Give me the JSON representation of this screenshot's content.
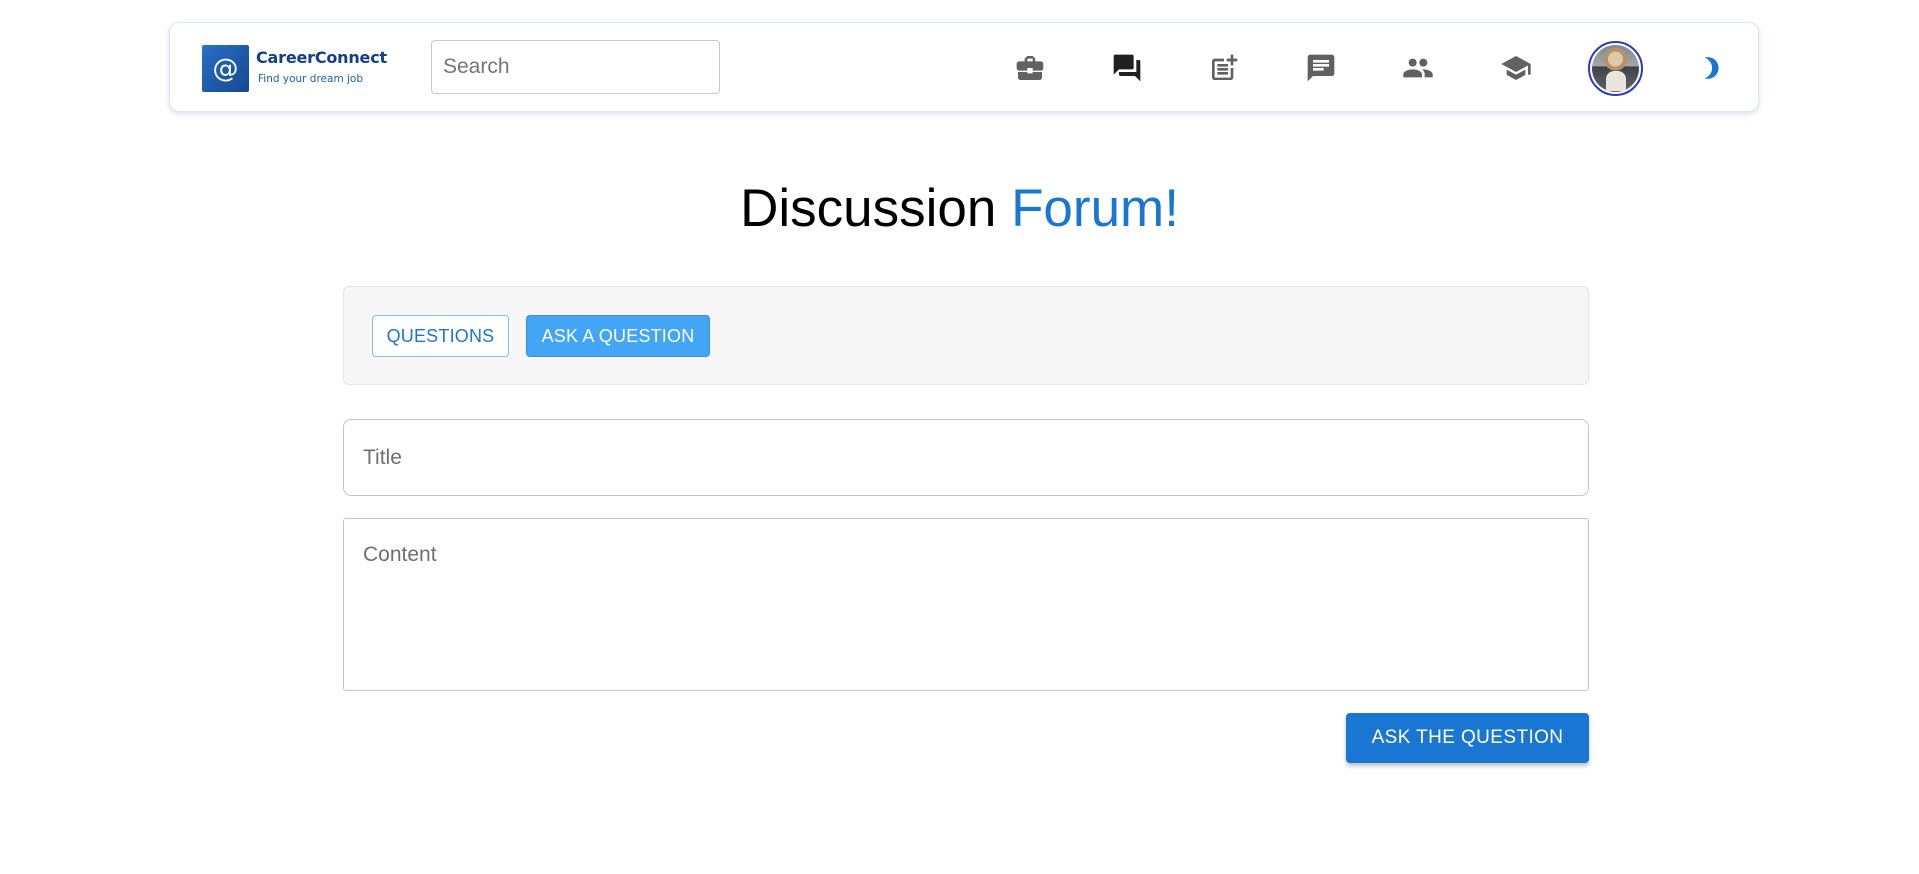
{
  "brand": {
    "logo_symbol": "@",
    "name": "CareerConnect",
    "tagline": "Find your dream job"
  },
  "search": {
    "placeholder": "Search",
    "value": ""
  },
  "nav": {
    "icons": [
      {
        "name": "briefcase-icon",
        "label": "Jobs",
        "active": false
      },
      {
        "name": "forum-icon",
        "label": "Forum",
        "active": true
      },
      {
        "name": "post-add-icon",
        "label": "Post",
        "active": false
      },
      {
        "name": "chat-icon",
        "label": "Messages",
        "active": false
      },
      {
        "name": "people-icon",
        "label": "Network",
        "active": false
      },
      {
        "name": "school-icon",
        "label": "Learning",
        "active": false
      }
    ],
    "avatar": "avatar",
    "theme_toggle": "moon-icon"
  },
  "page": {
    "title_part1": "Discussion ",
    "title_part2": "Forum!"
  },
  "tabs": {
    "questions_label": "QUESTIONS",
    "ask_label": "ASK A QUESTION",
    "active": "ASK A QUESTION"
  },
  "form": {
    "title_placeholder": "Title",
    "title_value": "",
    "content_placeholder": "Content",
    "content_value": "",
    "submit_label": "ASK THE QUESTION"
  },
  "colors": {
    "accent": "#1976d2",
    "active_tab": "#42a5f5",
    "icon_inactive": "#616161",
    "icon_active": "#212121"
  }
}
